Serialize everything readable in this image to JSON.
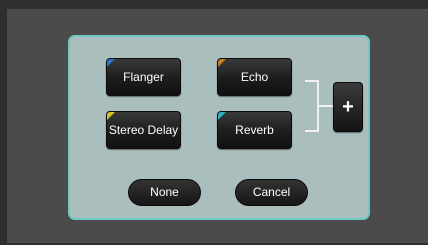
{
  "effects": [
    {
      "label": "Flanger",
      "accent": "#2e73c9"
    },
    {
      "label": "Echo",
      "accent": "#c97d22"
    },
    {
      "label": "Stereo Delay",
      "accent": "#d8c52a"
    },
    {
      "label": "Reverb",
      "accent": "#2fb0c4"
    }
  ],
  "add_button": {
    "label": "+"
  },
  "actions": {
    "none_label": "None",
    "cancel_label": "Cancel"
  },
  "colors": {
    "dialog_bg": "#a9bebd",
    "dialog_border": "#6ecac2",
    "backdrop": "#4b4b4b"
  }
}
